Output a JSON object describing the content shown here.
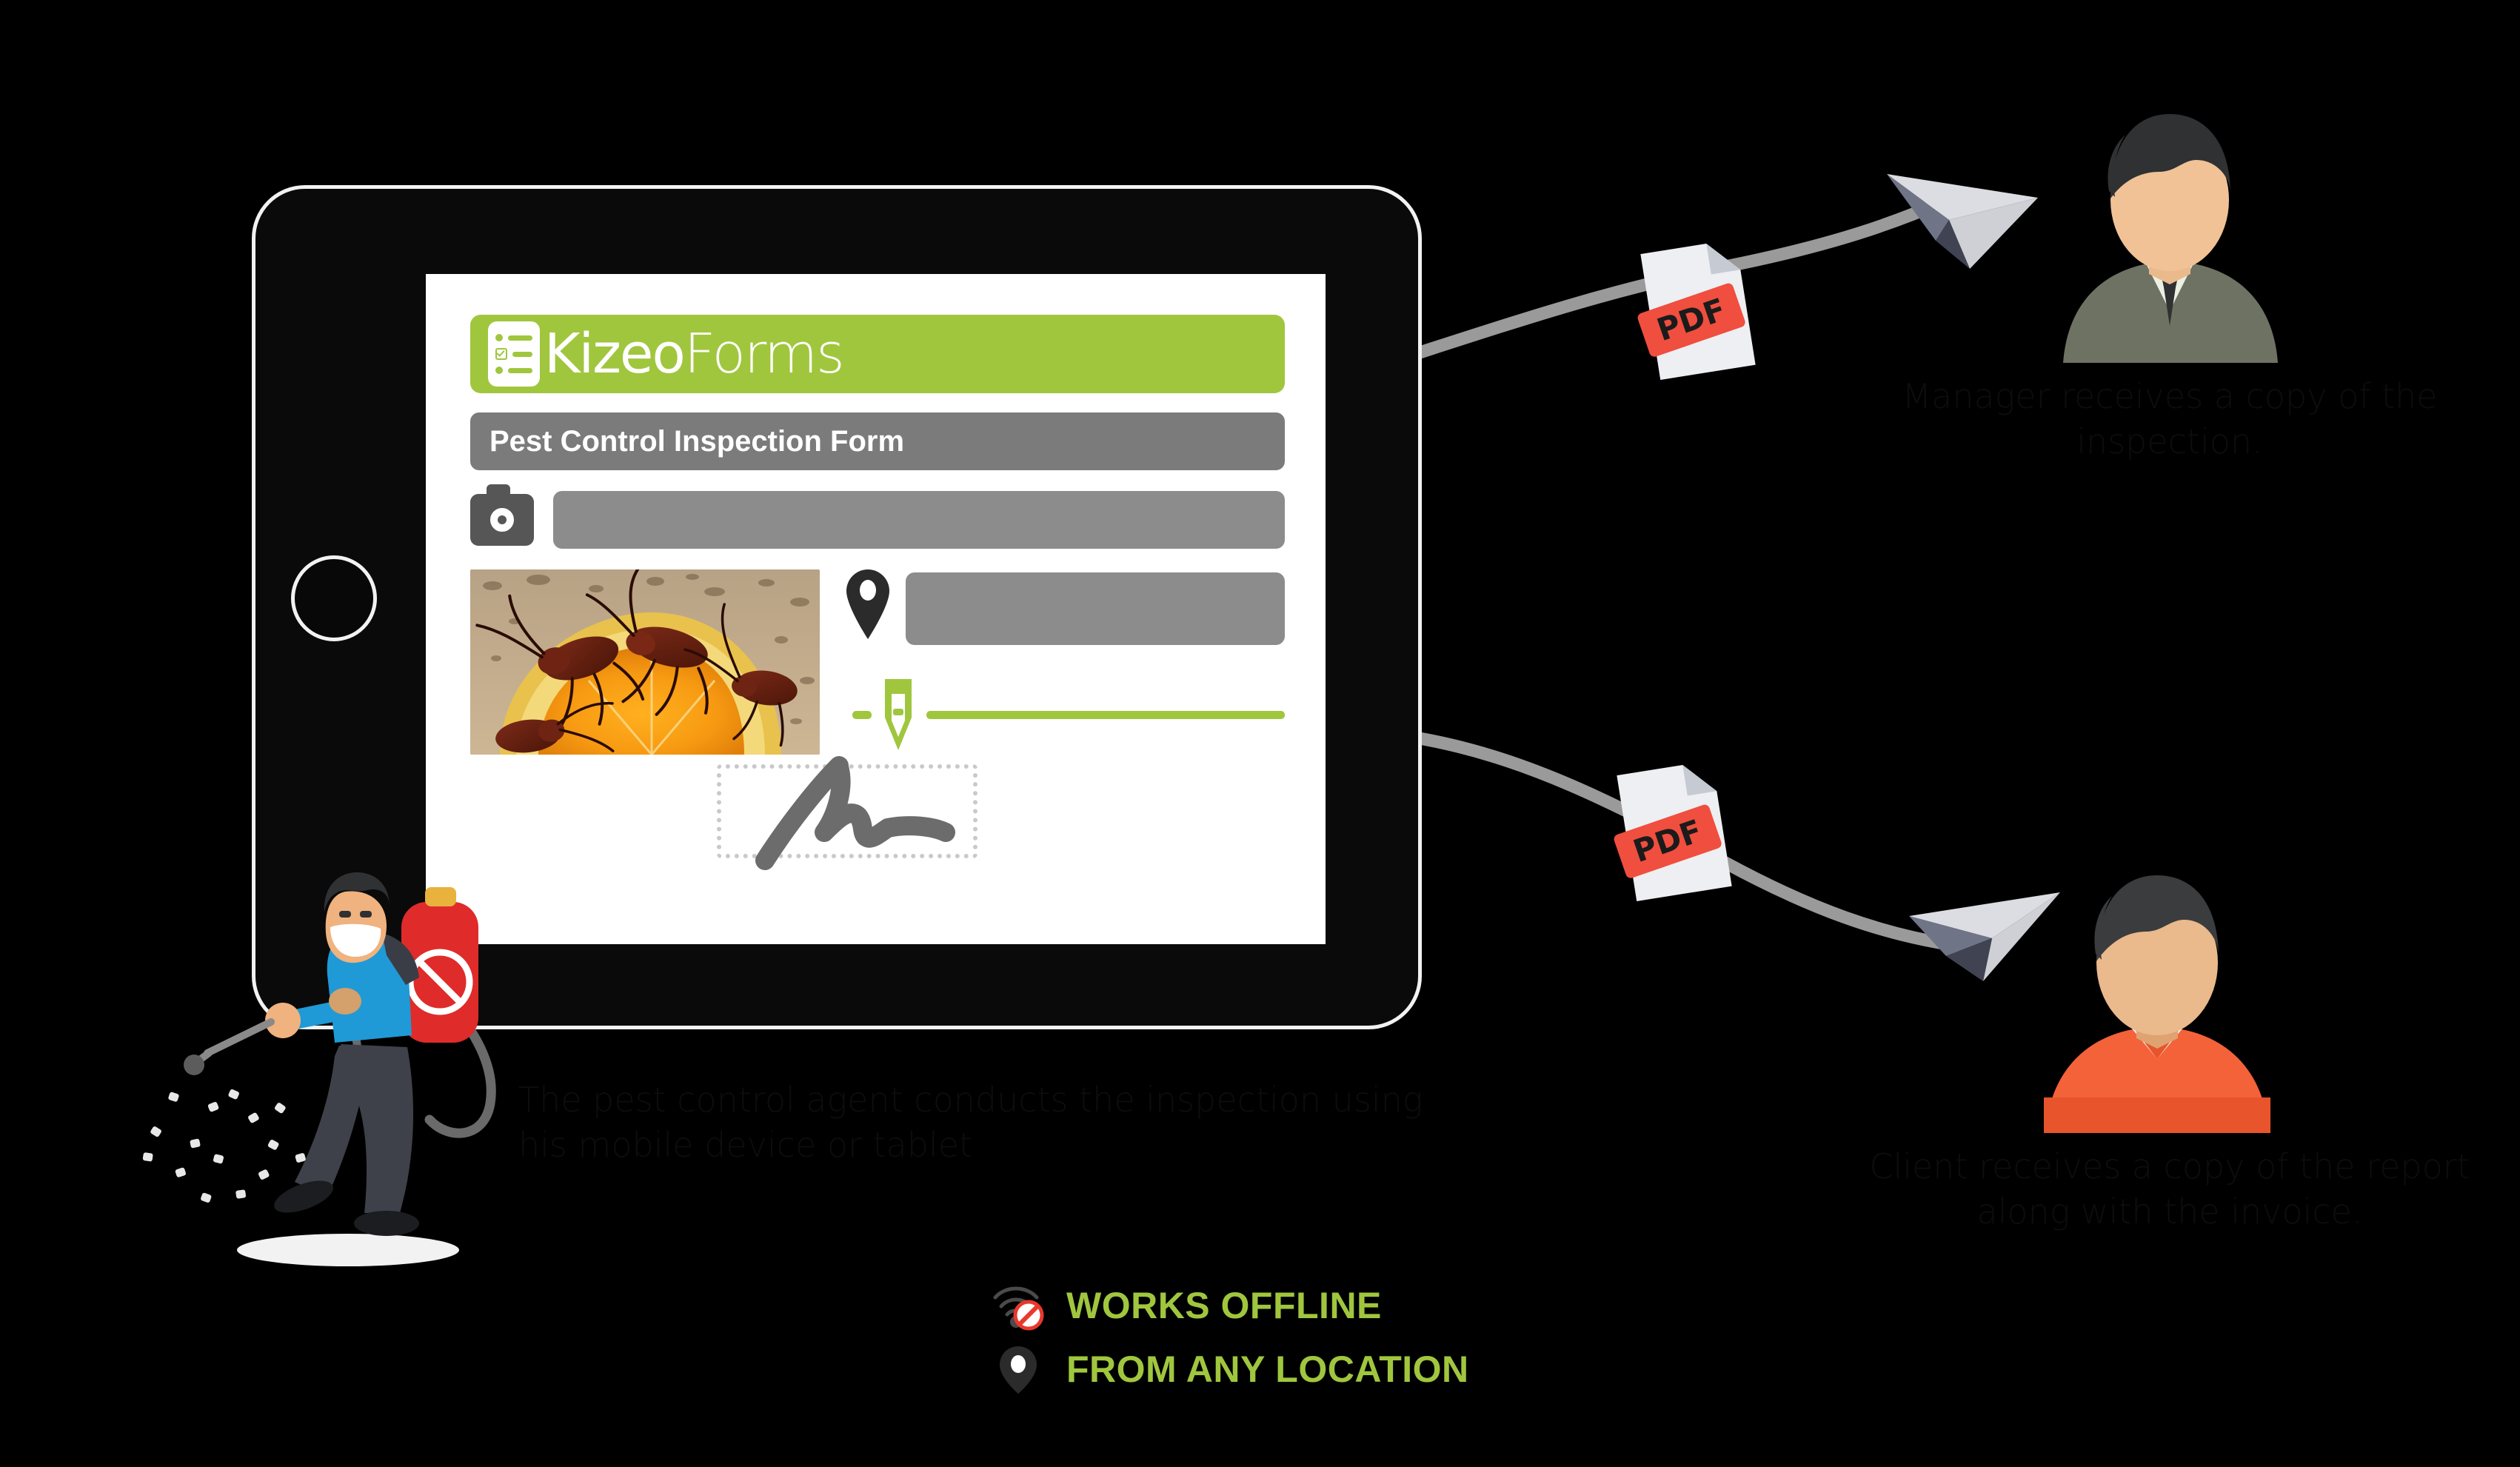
{
  "colors": {
    "background": "#000000",
    "brand_green": "#a0c63e",
    "form_grey": "#8c8c8c",
    "title_grey": "#7b7b7b",
    "pdf_red": "#f04e3e",
    "agent_shirt_blue": "#1f9ad6",
    "agent_tank_red": "#e02b2b",
    "client_shirt_orange": "#f4623a",
    "manager_suit": "#6e7263",
    "connector_grey": "#9a9a9a"
  },
  "tablet": {
    "device_label": "tablet-device",
    "app": {
      "logo_primary": "Kizeo",
      "logo_secondary": "Forms",
      "logo_icon": "checklist-icon",
      "form_title": "Pest Control Inspection Form",
      "fields": [
        {
          "name": "photo-attachment",
          "icon": "camera-icon",
          "value": ""
        },
        {
          "name": "location",
          "icon": "location-pin-icon",
          "value": ""
        },
        {
          "name": "signature-draw",
          "icon": "pen-icon",
          "value": ""
        }
      ],
      "photo_caption": "cockroaches-on-orange-photo",
      "signature_field": "signature-box"
    }
  },
  "captions": {
    "agent": "The pest control agent conducts the inspection using his mobile device or tablet",
    "manager": "Manager receives a copy of the inspection.",
    "client": "Client receives a copy of the report along with the invoice."
  },
  "badges": [
    {
      "icon": "wifi-off-icon",
      "label": "WORKS OFFLINE"
    },
    {
      "icon": "location-pin-icon",
      "label": "FROM ANY LOCATION"
    }
  ],
  "documents": [
    {
      "name": "pdf-document-manager",
      "label": "PDF"
    },
    {
      "name": "pdf-document-client",
      "label": "PDF"
    }
  ],
  "recipients": [
    {
      "name": "manager-avatar",
      "role": "Manager",
      "attire": "suit-and-tie"
    },
    {
      "name": "client-avatar",
      "role": "Client",
      "attire": "orange-shirt"
    }
  ],
  "actor": {
    "name": "pest-control-agent",
    "equipment": "backpack-sprayer"
  }
}
